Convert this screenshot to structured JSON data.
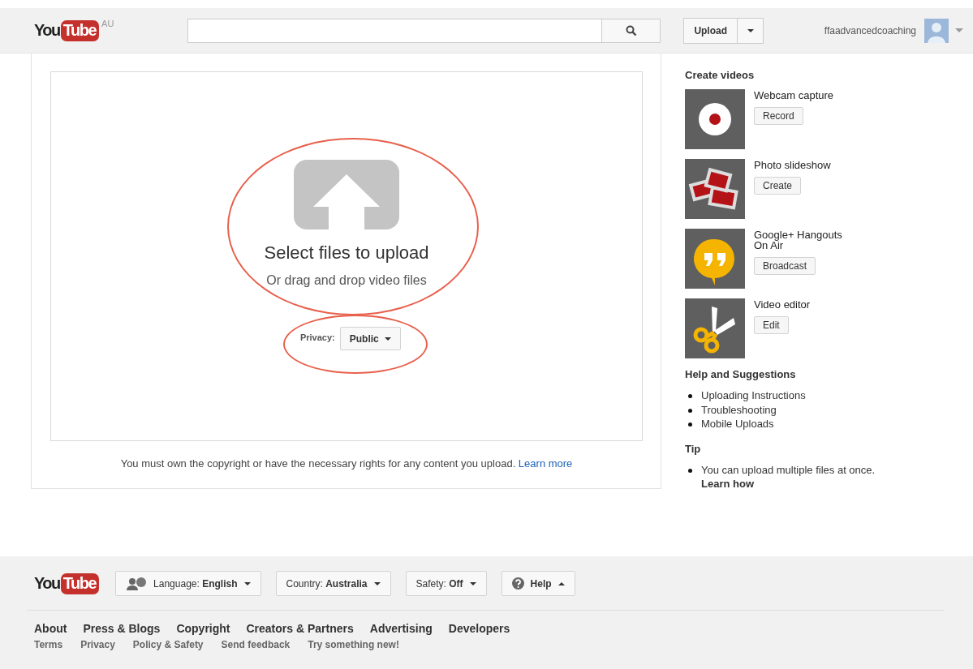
{
  "header": {
    "logo": {
      "you": "You",
      "tube": "Tube",
      "region": "AU"
    },
    "upload_button": "Upload",
    "user": {
      "name": "ffaadvancedcoaching"
    }
  },
  "upload": {
    "title": "Select files to upload",
    "subtitle": "Or drag and drop video files",
    "privacy": {
      "label": "Privacy:",
      "value": "Public"
    },
    "notice": "You must own the copyright or have the necessary rights for any content you upload.",
    "notice_link": "Learn more"
  },
  "sidebar": {
    "create_heading": "Create videos",
    "create_items": [
      {
        "kind": "record",
        "title": "Webcam capture",
        "button": "Record"
      },
      {
        "kind": "slideshow",
        "title": "Photo slideshow",
        "button": "Create"
      },
      {
        "kind": "hangout",
        "title": "Google+ Hangouts On Air",
        "button": "Broadcast"
      },
      {
        "kind": "editor",
        "title": "Video editor",
        "button": "Edit"
      }
    ],
    "help_heading": "Help and Suggestions",
    "help_links": [
      "Uploading Instructions",
      "Troubleshooting",
      "Mobile Uploads"
    ],
    "tip_heading": "Tip",
    "tip": {
      "text": "You can upload multiple files at once.",
      "link": "Learn how"
    }
  },
  "footer": {
    "logo": {
      "you": "You",
      "tube": "Tube"
    },
    "selectors": [
      {
        "kind": "language",
        "text": "Language: **English**",
        "expanded": false
      },
      {
        "kind": "plain",
        "text": "Country: **Australia**",
        "expanded": false
      },
      {
        "kind": "plain",
        "text": "Safety: **Off**",
        "expanded": false
      },
      {
        "kind": "help",
        "text": "**Help**",
        "expanded": true
      }
    ],
    "primary_links": [
      "About",
      "Press & Blogs",
      "Copyright",
      "Creators & Partners",
      "Advertising",
      "Developers"
    ],
    "secondary_links": [
      "Terms",
      "Privacy",
      "Policy & Safety",
      "Send feedback",
      "Try something new!"
    ]
  }
}
